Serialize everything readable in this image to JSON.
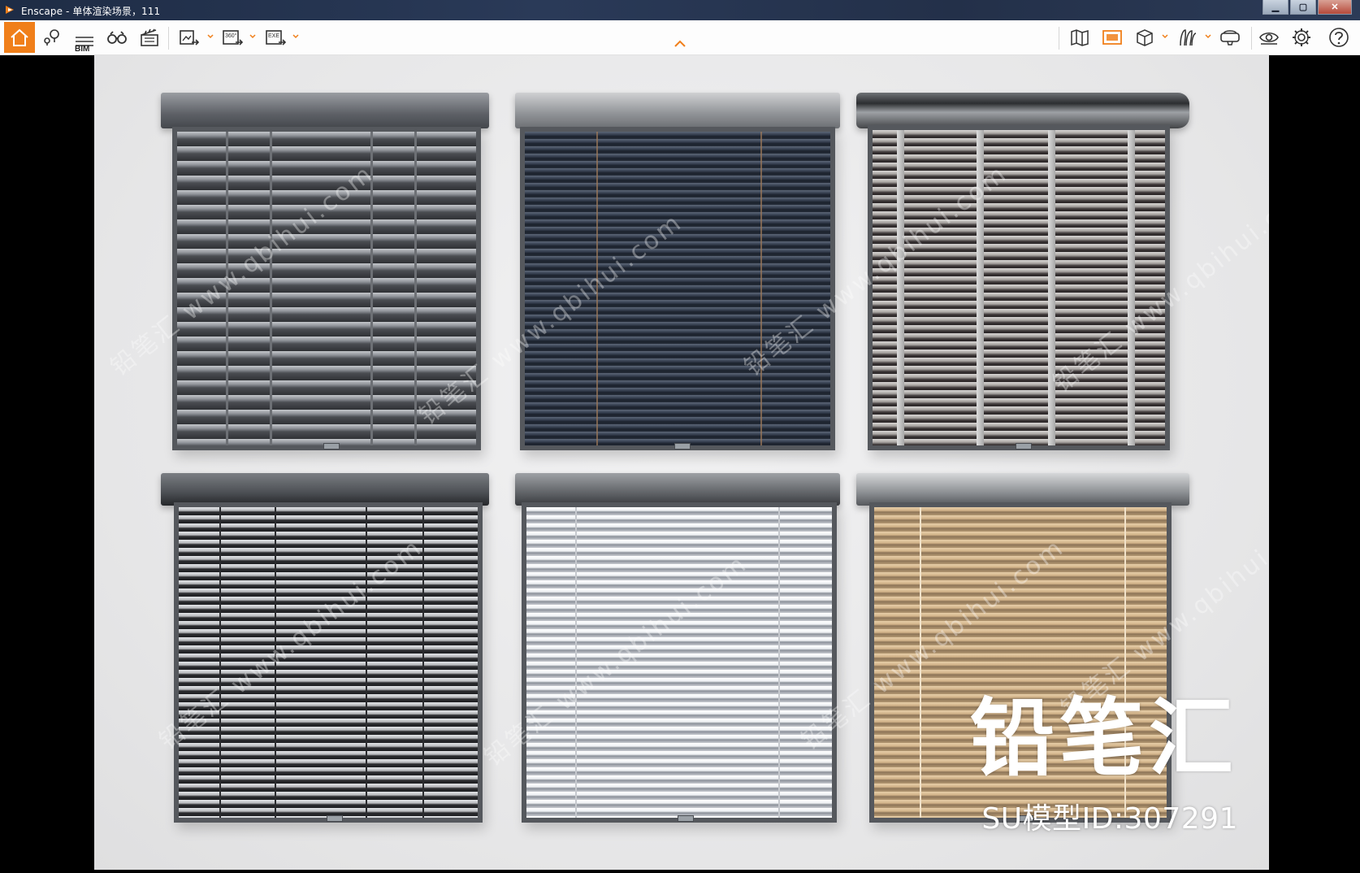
{
  "window": {
    "title": "Enscape - 单体渲染场景，111",
    "minimize_glyph": "▁",
    "maximize_glyph": "▢",
    "close_glyph": "✕"
  },
  "toolbar": {
    "accent_color": "#f07f1a",
    "left_tools": [
      {
        "icon": "home-icon",
        "active": true
      },
      {
        "icon": "location-pins-icon"
      },
      {
        "icon": "bim-list-icon",
        "label": "BIM"
      },
      {
        "icon": "binoculars-icon"
      },
      {
        "icon": "clapperboard-icon"
      },
      {
        "icon": "export-image-icon",
        "dropdown": true
      },
      {
        "icon": "export-360-icon",
        "label": "360°",
        "dropdown": true
      },
      {
        "icon": "export-exe-icon",
        "label": "EXE",
        "dropdown": true
      }
    ],
    "right_tools": [
      {
        "icon": "map-icon"
      },
      {
        "icon": "visual-settings-icon",
        "active": true
      },
      {
        "icon": "cube-view-icon",
        "dropdown": true
      },
      {
        "icon": "vegetation-icon",
        "dropdown": true
      },
      {
        "icon": "vr-headset-icon"
      },
      {
        "icon": "view-eye-icon"
      },
      {
        "icon": "gear-icon"
      },
      {
        "icon": "help-icon"
      }
    ]
  },
  "viewport": {
    "blinds": [
      {
        "name": "blind-dark-grey-wide-slat",
        "slat_color": "#8d9197",
        "gap_color": "#3a3c40"
      },
      {
        "name": "blind-navy-narrow-slat",
        "slat_color": "#3b4556",
        "gap_color": "#1b212c"
      },
      {
        "name": "blind-silver-wide-headrail",
        "slat_color": "#a9a5a2",
        "gap_color": "#2a2627"
      },
      {
        "name": "blind-black-slat",
        "slat_color": "#b8babd",
        "gap_color": "#1e1f22"
      },
      {
        "name": "blind-white-slat",
        "slat_color": "#eef0f3",
        "gap_color": "#8a9099"
      },
      {
        "name": "blind-tan-slat",
        "slat_color": "#d3b48a",
        "gap_color": "#8c7457"
      }
    ]
  },
  "watermark": {
    "brand": "铅笔汇",
    "model_id": "SU模型ID:307291",
    "tile_text": "铅笔汇 www.qbihui.com"
  }
}
